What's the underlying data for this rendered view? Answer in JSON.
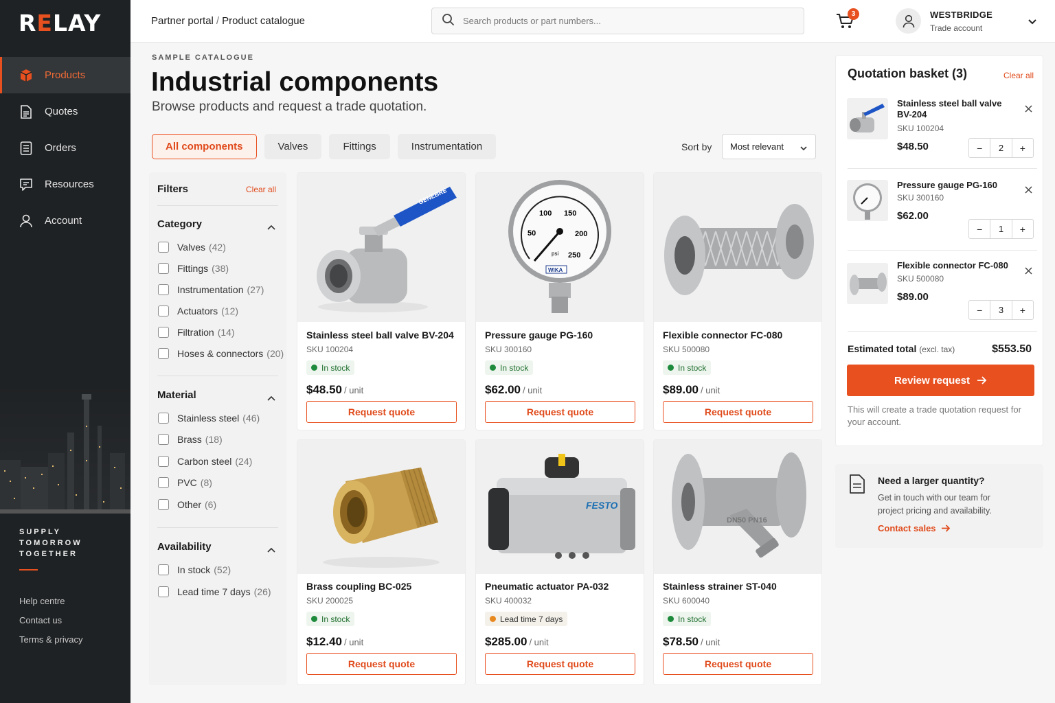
{
  "brand": {
    "logo_pre": "R",
    "logo_e": "E",
    "logo_post": "LAY",
    "accent": "#e8501f"
  },
  "sidebar": {
    "items": [
      {
        "label": "Products",
        "icon": "box-icon",
        "active": true
      },
      {
        "label": "Quotes",
        "icon": "document-icon"
      },
      {
        "label": "Orders",
        "icon": "list-icon"
      },
      {
        "label": "Resources",
        "icon": "chat-icon"
      },
      {
        "label": "Account",
        "icon": "user-icon"
      }
    ],
    "tagline": [
      "SUPPLY",
      "TOMORROW",
      "TOGETHER"
    ],
    "footer_links": [
      "Help centre",
      "Contact us",
      "Terms & privacy"
    ]
  },
  "header": {
    "breadcrumb_root": "Partner portal",
    "breadcrumb_sep": "/",
    "breadcrumb_current": "Product catalogue",
    "search_placeholder": "Search products or part numbers...",
    "cart_count": "3",
    "account_name": "WESTBRIDGE",
    "account_type": "Trade account"
  },
  "main": {
    "eyebrow": "SAMPLE CATALOGUE",
    "title": "Industrial components",
    "subtitle": "Browse products and request a trade quotation.",
    "tabs": [
      "All components",
      "Valves",
      "Fittings",
      "Instrumentation"
    ],
    "sort_label": "Sort by",
    "sort_value": "Most relevant"
  },
  "filters": {
    "title": "Filters",
    "clear": "Clear all",
    "sections": [
      {
        "title": "Category",
        "options": [
          {
            "label": "Valves",
            "count": "(42)"
          },
          {
            "label": "Fittings",
            "count": "(38)"
          },
          {
            "label": "Instrumentation",
            "count": "(27)"
          },
          {
            "label": "Actuators",
            "count": "(12)"
          },
          {
            "label": "Filtration",
            "count": "(14)"
          },
          {
            "label": "Hoses & connectors",
            "count": "(20)"
          }
        ]
      },
      {
        "title": "Material",
        "options": [
          {
            "label": "Stainless steel",
            "count": "(46)"
          },
          {
            "label": "Brass",
            "count": "(18)"
          },
          {
            "label": "Carbon steel",
            "count": "(24)"
          },
          {
            "label": "PVC",
            "count": "(8)"
          },
          {
            "label": "Other",
            "count": "(6)"
          }
        ]
      },
      {
        "title": "Availability",
        "options": [
          {
            "label": "In stock",
            "count": "(52)"
          },
          {
            "label": "Lead time 7 days",
            "count": "(26)"
          }
        ]
      }
    ]
  },
  "products": [
    {
      "name": "Stainless steel ball valve BV-204",
      "sku": "SKU 100204",
      "status": "In stock",
      "price": "$48.50",
      "unit": "/ unit",
      "cta": "Request quote",
      "image": "ball-valve-image",
      "brand_mark": "GENEBRE"
    },
    {
      "name": "Pressure gauge PG-160",
      "sku": "SKU 300160",
      "status": "In stock",
      "price": "$62.00",
      "unit": "/ unit",
      "cta": "Request quote",
      "image": "pressure-gauge-image",
      "brand_mark": "WIKA"
    },
    {
      "name": "Flexible connector FC-080",
      "sku": "SKU 500080",
      "status": "In stock",
      "price": "$89.00",
      "unit": "/ unit",
      "cta": "Request quote",
      "image": "flexible-connector-image"
    },
    {
      "name": "Brass coupling BC-025",
      "sku": "SKU 200025",
      "status": "In stock",
      "price": "$12.40",
      "unit": "/ unit",
      "cta": "Request quote",
      "image": "brass-coupling-image"
    },
    {
      "name": "Pneumatic actuator PA-032",
      "sku": "SKU 400032",
      "status": "Lead time 7 days",
      "price": "$285.00",
      "unit": "/ unit",
      "cta": "Request quote",
      "image": "pneumatic-actuator-image",
      "brand_mark": "FESTO"
    },
    {
      "name": "Stainless strainer ST-040",
      "sku": "SKU 600040",
      "status": "In stock",
      "price": "$78.50",
      "unit": "/ unit",
      "cta": "Request quote",
      "image": "strainer-image",
      "brand_mark": "DN50 PN16"
    }
  ],
  "basket": {
    "title": "Quotation basket (3)",
    "clear": "Clear all",
    "items": [
      {
        "name": "Stainless steel ball valve BV-204",
        "sku": "SKU 100204",
        "price": "$48.50",
        "qty": "2"
      },
      {
        "name": "Pressure gauge PG-160",
        "sku": "SKU 300160",
        "price": "$62.00",
        "qty": "1"
      },
      {
        "name": "Flexible connector FC-080",
        "sku": "SKU 500080",
        "price": "$89.00",
        "qty": "3"
      }
    ],
    "total_label": "Estimated total",
    "total_note": "(excl. tax)",
    "total_value": "$553.50",
    "review": "Review request",
    "note": "This will create a trade quotation request for your account."
  },
  "help": {
    "title": "Need a larger quantity?",
    "body": "Get in touch with our team for project pricing and availability.",
    "link": "Contact sales"
  }
}
